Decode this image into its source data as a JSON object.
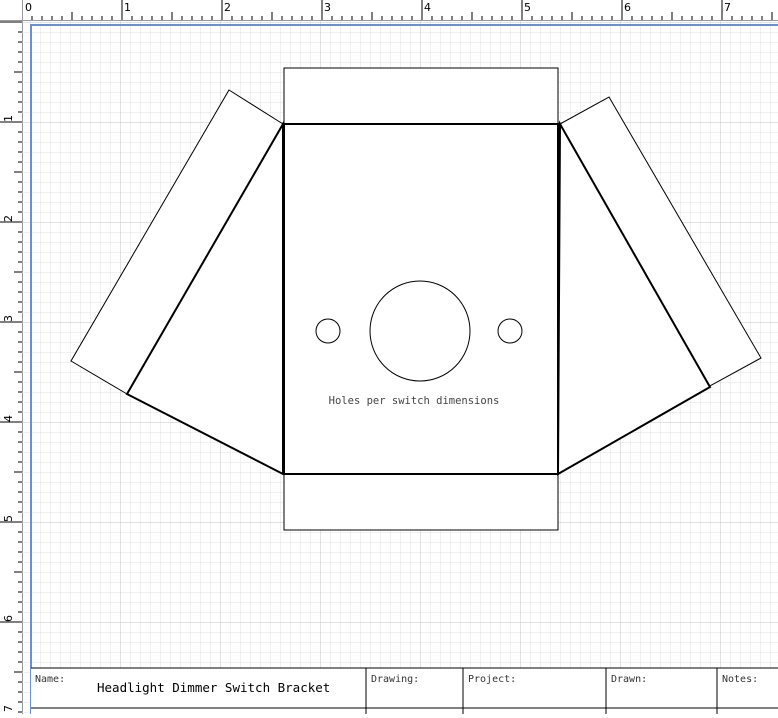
{
  "ruler": {
    "horizontal_labels": [
      "0",
      "1",
      "2",
      "3",
      "4",
      "5",
      "6",
      "7"
    ],
    "vertical_labels": [
      "1",
      "2",
      "3",
      "4",
      "5",
      "6",
      "7"
    ]
  },
  "drawing": {
    "caption": "Holes per switch dimensions"
  },
  "title_block": {
    "name_label": "Name:",
    "name_value": "Headlight Dimmer Switch Bracket",
    "drawing_label": "Drawing:",
    "project_label": "Project:",
    "drawn_label": "Drawn:",
    "notes_label": "Notes:"
  },
  "colors": {
    "grid_minor": "#e2e2e2",
    "grid_major": "#c4c4c4",
    "page_border": "#6b8fd6",
    "outline": "#000000"
  }
}
